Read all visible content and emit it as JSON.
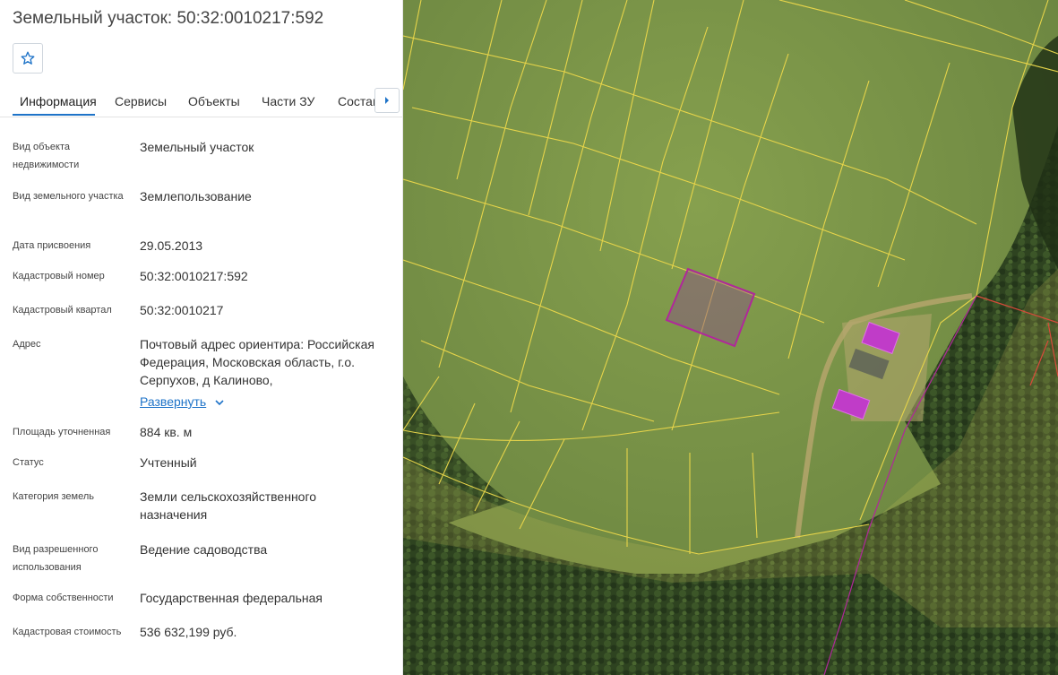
{
  "header": {
    "title": "Земельный участок: 50:32:0010217:592",
    "favorite_icon": "star-icon"
  },
  "tabs": [
    {
      "label": "Информация",
      "active": true
    },
    {
      "label": "Сервисы",
      "active": false
    },
    {
      "label": "Объекты",
      "active": false
    },
    {
      "label": "Части ЗУ",
      "active": false
    },
    {
      "label": "Состав",
      "active": false
    }
  ],
  "info": {
    "object_type": {
      "label": "Вид объекта недвижимости",
      "value": "Земельный участок"
    },
    "land_type": {
      "label": "Вид земельного участка",
      "value": "Землепользование"
    },
    "assign_date": {
      "label": "Дата присвоения",
      "value": "29.05.2013"
    },
    "cadastral_number": {
      "label": "Кадастровый номер",
      "value": "50:32:0010217:592"
    },
    "cadastral_quarter": {
      "label": "Кадастровый квартал",
      "value": "50:32:0010217"
    },
    "address": {
      "label": "Адрес",
      "value": "Почтовый адрес ориентира: Российская Федерация, Московская область, г.о. Серпухов, д Калиново,",
      "expand_label": "Развернуть"
    },
    "area": {
      "label": "Площадь уточненная",
      "value": "884 кв. м"
    },
    "status": {
      "label": "Статус",
      "value": "Учтенный"
    },
    "land_category": {
      "label": "Категория земель",
      "value": "Земли сельскохозяйственного назначения"
    },
    "permitted_use": {
      "label": "Вид разрешенного использования",
      "value": "Ведение садоводства"
    },
    "ownership": {
      "label": "Форма собственности",
      "value": "Государственная федеральная"
    },
    "cadastral_value": {
      "label": "Кадастровая стоимость",
      "value": "536 632,199 руб."
    }
  },
  "map": {
    "layer": "satellite",
    "colors": {
      "parcel_lines": "#e6d44a",
      "selected_parcel": "#b0289a",
      "building_fill": "#c03cc8",
      "other_boundary": "#d84a3a",
      "meadow": "#7a9046",
      "forest": "#2f4520"
    }
  }
}
